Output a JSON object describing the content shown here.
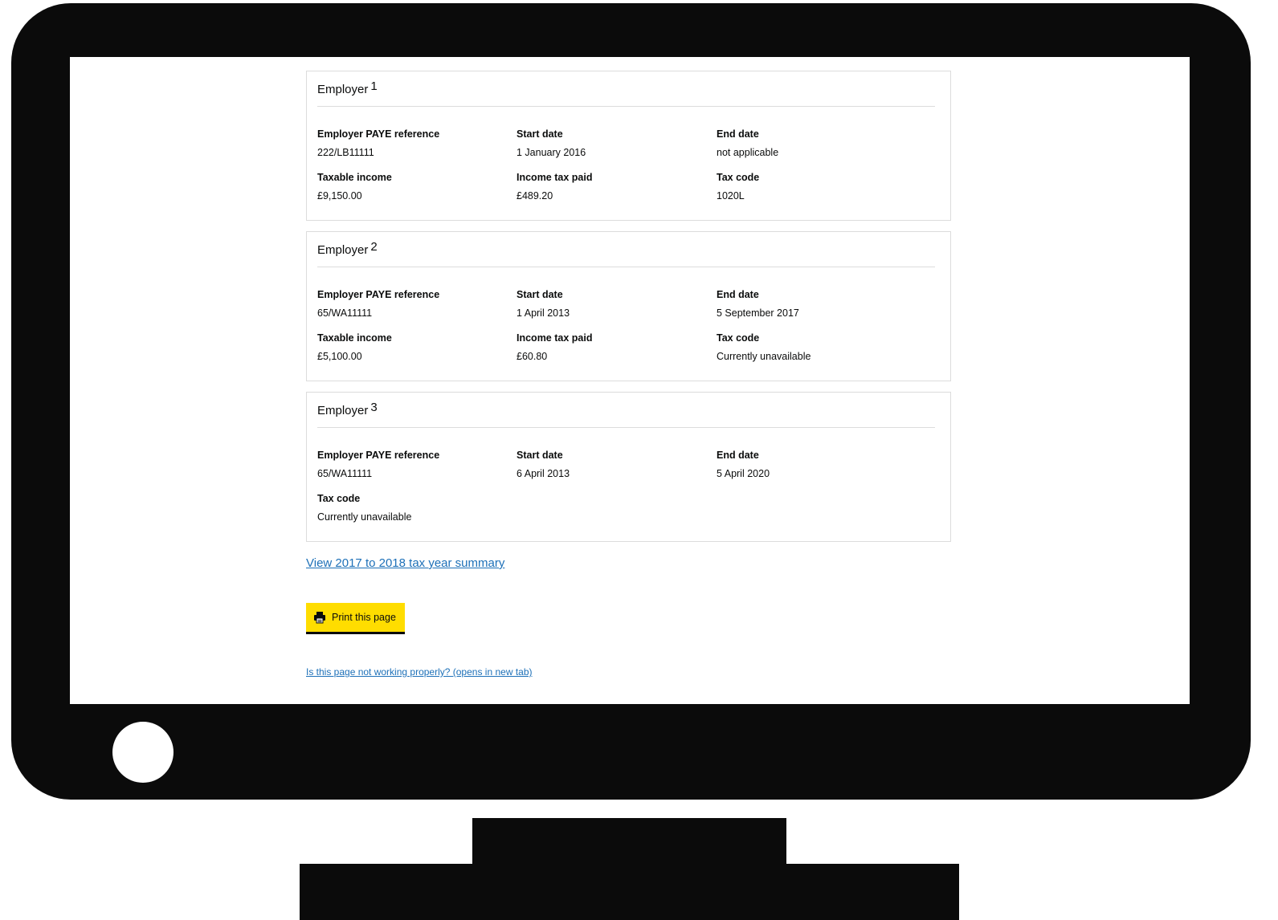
{
  "employers": [
    {
      "title": "Employer",
      "number": "1",
      "fields": [
        {
          "label": "Employer PAYE reference",
          "value": "222/LB11111"
        },
        {
          "label": "Start date",
          "value": "1 January 2016"
        },
        {
          "label": "End date",
          "value": "not applicable"
        },
        {
          "label": "Taxable income",
          "value": "£9,150.00"
        },
        {
          "label": "Income tax paid",
          "value": "£489.20"
        },
        {
          "label": "Tax code",
          "value": "1020L"
        }
      ]
    },
    {
      "title": "Employer",
      "number": "2",
      "fields": [
        {
          "label": "Employer PAYE reference",
          "value": "65/WA11111"
        },
        {
          "label": "Start date",
          "value": "1 April 2013"
        },
        {
          "label": "End date",
          "value": "5 September 2017"
        },
        {
          "label": "Taxable income",
          "value": "£5,100.00"
        },
        {
          "label": "Income tax paid",
          "value": "£60.80"
        },
        {
          "label": "Tax code",
          "value": "Currently unavailable"
        }
      ]
    },
    {
      "title": "Employer",
      "number": "3",
      "fields": [
        {
          "label": "Employer PAYE reference",
          "value": "65/WA11111"
        },
        {
          "label": "Start date",
          "value": "6 April 2013"
        },
        {
          "label": "End date",
          "value": "5 April 2020"
        },
        {
          "label": "Tax code",
          "value": "Currently unavailable"
        }
      ]
    }
  ],
  "links": {
    "summary": "View 2017 to 2018 tax year summary",
    "report": "Is this page not working properly? (opens in new tab)"
  },
  "print_button": {
    "label": "Print this page",
    "icon": "printer-icon"
  },
  "colors": {
    "link": "#1d70b8",
    "button": "#ffdd00",
    "border": "#dcdcdc",
    "monitor": "#0b0b0b"
  }
}
